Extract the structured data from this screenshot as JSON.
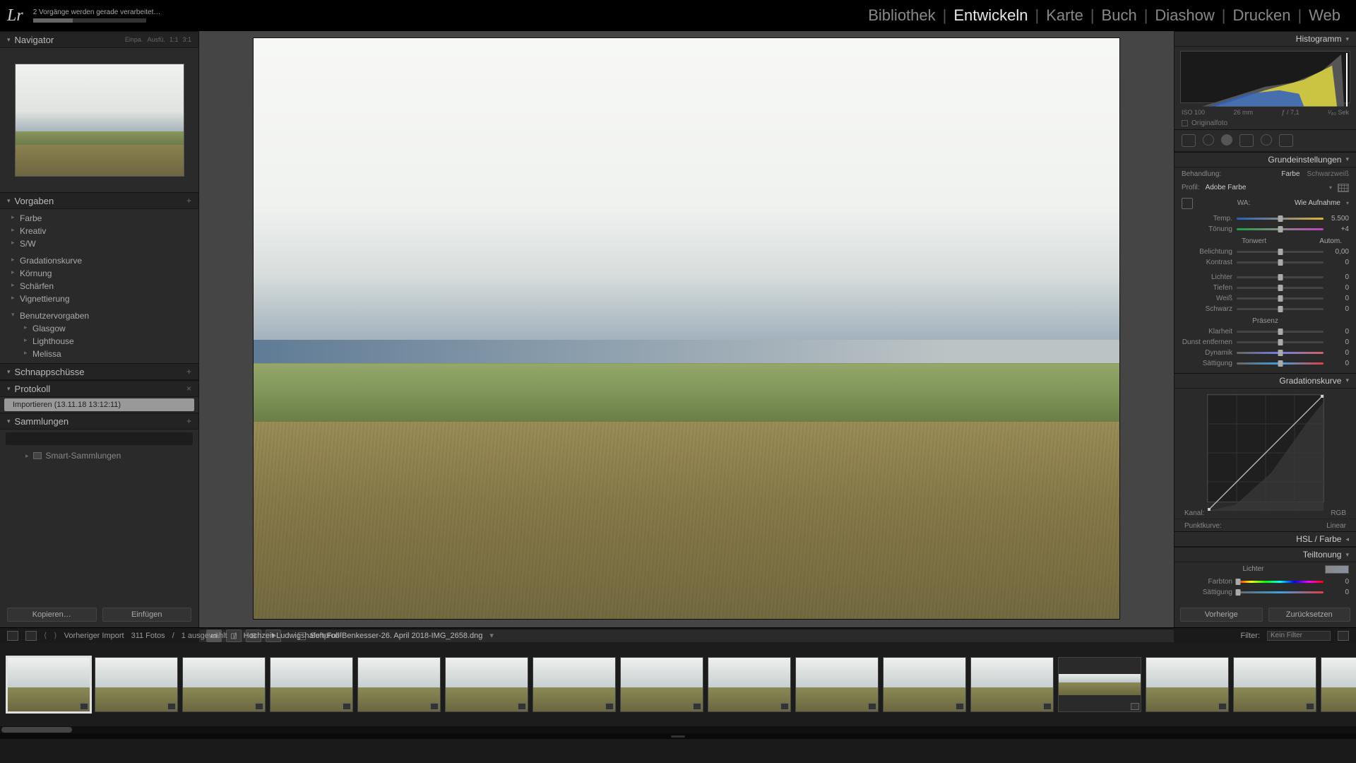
{
  "app": {
    "logo": "Lr",
    "status": "2 Vorgänge werden gerade verarbeitet…"
  },
  "modules": {
    "items": [
      "Bibliothek",
      "Entwickeln",
      "Karte",
      "Buch",
      "Diashow",
      "Drucken",
      "Web"
    ],
    "active": "Entwickeln"
  },
  "left": {
    "navigator": {
      "title": "Navigator",
      "zoom1": "Einpa.",
      "zoom2": "Ausfü.",
      "zoom3": "1:1",
      "zoom4": "3:1"
    },
    "presets": {
      "title": "Vorgaben",
      "items": [
        "Farbe",
        "Kreativ",
        "S/W",
        "Gradationskurve",
        "Körnung",
        "Schärfen",
        "Vignettierung"
      ],
      "user_title": "Benutzervorgaben",
      "user_items": [
        "Glasgow",
        "Lighthouse",
        "Melissa"
      ]
    },
    "snapshots": {
      "title": "Schnappschüsse"
    },
    "history": {
      "title": "Protokoll",
      "entry": "Importieren (13.11.18 13:12:11)"
    },
    "collections": {
      "title": "Sammlungen",
      "smart": "Smart-Sammlungen"
    },
    "buttons": {
      "copy": "Kopieren…",
      "paste": "Einfügen"
    }
  },
  "center": {
    "softproof": "Softproof"
  },
  "right": {
    "histogram": {
      "title": "Histogramm",
      "iso": "ISO 100",
      "focal": "26 mm",
      "aperture": "ƒ / 7,1",
      "shutter": "¹⁄₈₀ Sek",
      "original": "Originalfoto"
    },
    "basic": {
      "title": "Grundeinstellungen",
      "treatment_label": "Behandlung:",
      "treatment_color": "Farbe",
      "treatment_bw": "Schwarzweiß",
      "profile_label": "Profil:",
      "profile_value": "Adobe Farbe",
      "wb_label": "WA:",
      "wb_value": "Wie Aufnahme",
      "temp_label": "Temp.",
      "temp_value": "5.500",
      "tint_label": "Tönung",
      "tint_value": "+4",
      "tone_header": "Tonwert",
      "tone_auto": "Autom.",
      "exposure_label": "Belichtung",
      "exposure_value": "0,00",
      "contrast_label": "Kontrast",
      "contrast_value": "0",
      "highlights_label": "Lichter",
      "highlights_value": "0",
      "shadows_label": "Tiefen",
      "shadows_value": "0",
      "whites_label": "Weiß",
      "whites_value": "0",
      "blacks_label": "Schwarz",
      "blacks_value": "0",
      "presence_header": "Präsenz",
      "clarity_label": "Klarheit",
      "clarity_value": "0",
      "dehaze_label": "Dunst entfernen",
      "dehaze_value": "0",
      "vibrance_label": "Dynamik",
      "vibrance_value": "0",
      "saturation_label": "Sättigung",
      "saturation_value": "0"
    },
    "tonecurve": {
      "title": "Gradationskurve",
      "channel_label": "Kanal:",
      "channel_value": "RGB",
      "pointcurve_label": "Punktkurve:",
      "pointcurve_value": "Linear"
    },
    "hsl": {
      "title": "HSL / Farbe"
    },
    "split": {
      "title": "Teiltonung",
      "highlights": "Lichter",
      "hue_label": "Farbton",
      "hue_value": "0",
      "sat_label": "Sättigung",
      "sat_value": "0"
    },
    "buttons": {
      "previous": "Vorherige",
      "reset": "Zurücksetzen"
    }
  },
  "infobar": {
    "source": "Vorheriger Import",
    "count": "311 Fotos",
    "selected": "1 ausgewählt",
    "filename": "Hochzeit-Ludwigshafen-Full-Benkesser-26. April 2018-IMG_2658.dng",
    "filter_label": "Filter:",
    "filter_value": "Kein Filter"
  },
  "filmstrip": {
    "count": 16,
    "selected_index": 0,
    "narrow_index": 12
  }
}
